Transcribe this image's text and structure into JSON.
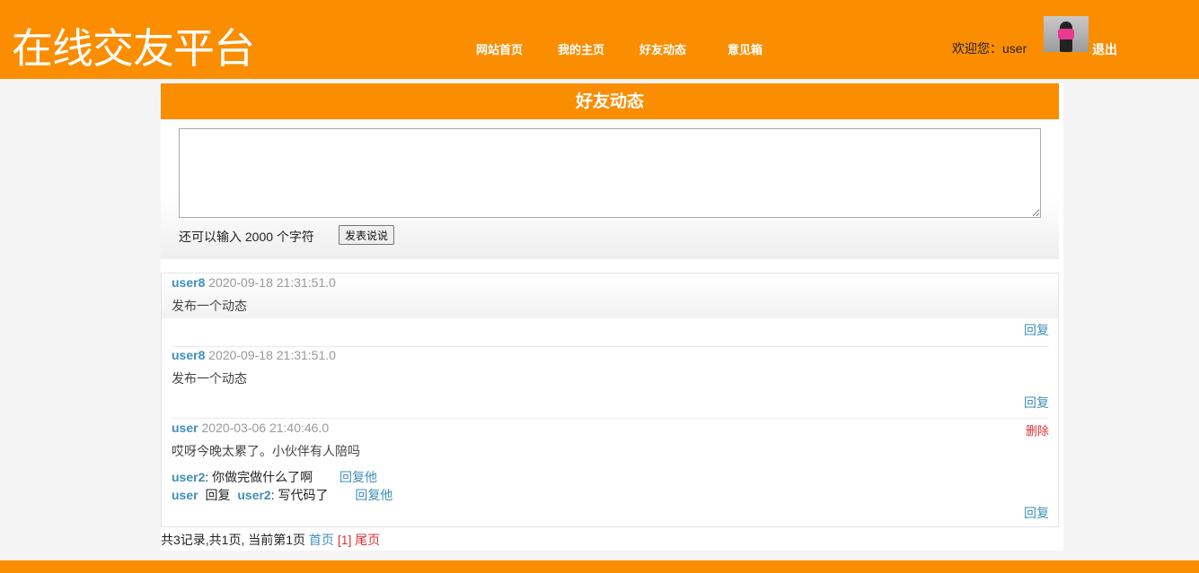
{
  "header": {
    "site_title": "在线交友平台",
    "nav": [
      "网站首页",
      "我的主页",
      "好友动态",
      "意见箱"
    ],
    "welcome": "欢迎您：user",
    "logout": "退出"
  },
  "banner": {
    "title": "好友动态"
  },
  "post_form": {
    "textarea_value": "",
    "remaining_prefix": "还可以输入",
    "remaining_count": "2000",
    "remaining_suffix": "个字符",
    "submit_label": "发表说说"
  },
  "feed": [
    {
      "user": "user8",
      "time": "2020-09-18 21:31:51.0",
      "content": "发布一个动态",
      "reply_label": "回复"
    },
    {
      "user": "user8",
      "time": "2020-09-18 21:31:51.0",
      "content": "发布一个动态",
      "reply_label": "回复"
    },
    {
      "user": "user",
      "time": "2020-03-06 21:40:46.0",
      "content": "哎呀今晚太累了。小伙伴有人陪吗",
      "delete_label": "删除",
      "reply_label": "回复",
      "replies": [
        {
          "from": "user2",
          "text": ": 你做完做什么了啊",
          "link": "回复他"
        },
        {
          "from": "user",
          "verb": "回复",
          "to": "user2",
          "text": ":   写代码了",
          "link": "回复他"
        }
      ]
    }
  ],
  "pager": {
    "summary": "共3记录,共1页, 当前第1页",
    "first": "首页",
    "current": "[1]",
    "last": "尾页"
  },
  "colors": {
    "accent": "#fb8d00",
    "link": "#3e8fb8",
    "danger": "#e03030"
  }
}
